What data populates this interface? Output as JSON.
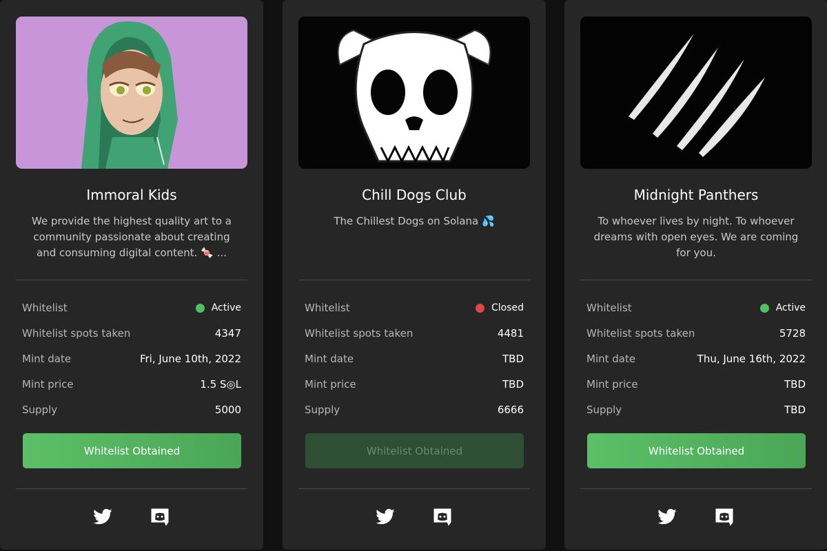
{
  "cards": [
    {
      "title": "Immoral Kids",
      "description": "We provide the highest quality art to a community passionate about creating and consuming digital content. 🍬 ...",
      "rows": [
        {
          "label": "Whitelist",
          "value": "Active",
          "status": "active"
        },
        {
          "label": "Whitelist spots taken",
          "value": "4347"
        },
        {
          "label": "Mint date",
          "value": "Fri, June 10th, 2022"
        },
        {
          "label": "Mint price",
          "value": "1.5 S◎L"
        },
        {
          "label": "Supply",
          "value": "5000"
        }
      ],
      "button_label": "Whitelist Obtained",
      "button_state": "active",
      "art_icon": "hooded-kid-illustration",
      "art_bg": "#c896d8"
    },
    {
      "title": "Chill Dogs Club",
      "description": "The Chillest Dogs on Solana 💦",
      "rows": [
        {
          "label": "Whitelist",
          "value": "Closed",
          "status": "closed"
        },
        {
          "label": "Whitelist spots taken",
          "value": "4481"
        },
        {
          "label": "Mint date",
          "value": "TBD"
        },
        {
          "label": "Mint price",
          "value": "TBD"
        },
        {
          "label": "Supply",
          "value": "6666"
        }
      ],
      "button_label": "Whitelist Obtained",
      "button_state": "disabled",
      "art_icon": "dog-skull-illustration",
      "art_bg": "#050505"
    },
    {
      "title": "Midnight Panthers",
      "description": "To whoever lives by night. To whoever dreams with open eyes. We are coming for you.",
      "rows": [
        {
          "label": "Whitelist",
          "value": "Active",
          "status": "active"
        },
        {
          "label": "Whitelist spots taken",
          "value": "5728"
        },
        {
          "label": "Mint date",
          "value": "Thu, June 16th, 2022"
        },
        {
          "label": "Mint price",
          "value": "TBD"
        },
        {
          "label": "Supply",
          "value": "TBD"
        }
      ],
      "button_label": "Whitelist Obtained",
      "button_state": "active",
      "art_icon": "claw-marks-illustration",
      "art_bg": "#030303"
    }
  ],
  "colors": {
    "active": "#4fbf62",
    "closed": "#e04848",
    "card_bg": "#262626",
    "button": "#55b561"
  },
  "social_icons": [
    "twitter-icon",
    "discord-icon"
  ]
}
